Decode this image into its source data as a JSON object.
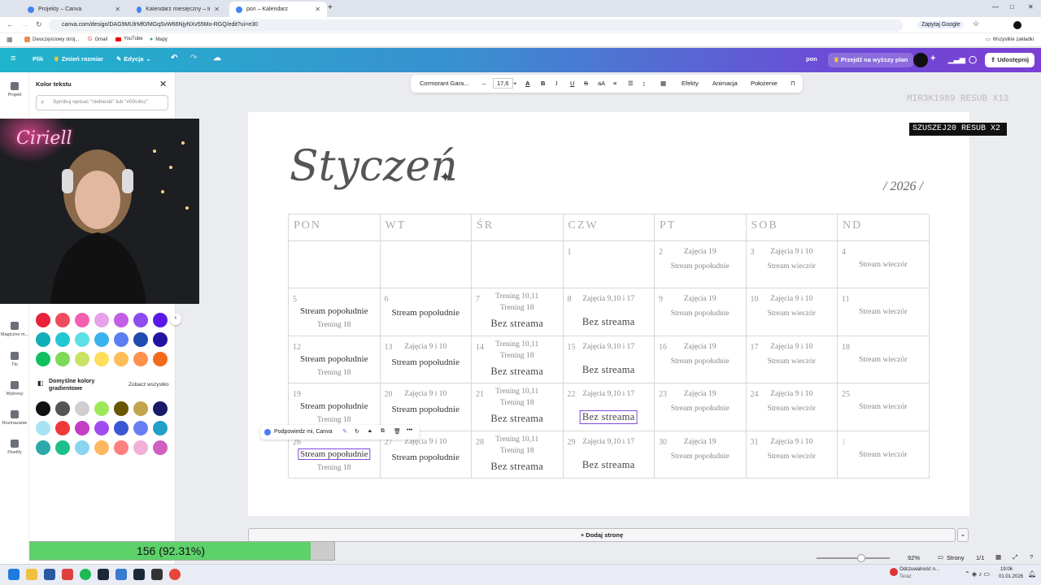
{
  "browser": {
    "tabs": [
      {
        "label": "Projekty – Canva",
        "active": false
      },
      {
        "label": "Kalendarz miesięczny – listopa...",
        "active": false
      },
      {
        "label": "pon – Kalendarz",
        "active": true
      }
    ],
    "url": "canva.com/design/DAG9MUlrMf0/MGqSvW66NjyNXv55Mo-RGQ/edit?ui=e30",
    "google_btn": "Zapytaj Google",
    "bookmarks": [
      "Dwuczęściowy stroj...",
      "Gmail",
      "YouTube",
      "Mapy"
    ],
    "all_bookmarks": "Wszystkie zakładki"
  },
  "canva_header": {
    "file": "Plik",
    "resize": "Zmień rozmiar",
    "edit": "Edycja",
    "project_name": "pon",
    "upgrade": "Przejdź na wyższy plan",
    "share": "Udostępnij"
  },
  "rail": [
    "Projekt",
    "Magiczne m...",
    "Tło",
    "Wykresy",
    "Rozmazanie",
    "Pixelify"
  ],
  "color_panel": {
    "title": "Kolor tekstu",
    "search_placeholder": "Spróbuj wpisać \"niebieski\" lub \"#00c4cc\"",
    "gradient_title": "Domyślne kolory gradientowe",
    "see_all": "Zobacz wszystko",
    "solid_rows": [
      [
        "#e9213a",
        "#f04c5f",
        "#f55fb0",
        "#e9a1ea",
        "#c25ee6",
        "#8e4cf0",
        "#5a18e8"
      ],
      [
        "#10aeb8",
        "#22c7d4",
        "#5ce0e6",
        "#3bb2f0",
        "#5b7ff2",
        "#1f4ab0",
        "#2412a0"
      ],
      [
        "#10c060",
        "#7ed957",
        "#c9e265",
        "#ffde59",
        "#ffbd59",
        "#ff914d",
        "#f26b1d"
      ]
    ],
    "gradient_rows": [
      [
        "#111111",
        "#555555",
        "#cfcfcf",
        "#9ee85a",
        "#6a5500",
        "#c2a44a",
        "#1a1a6a"
      ],
      [
        "#a7e3f5",
        "#ee3a3a",
        "#c23ec4",
        "#a04cf0",
        "#3a56d4",
        "#6a7ef4",
        "#20a0c8"
      ],
      [
        "#2ea8a8",
        "#1ec08a",
        "#8ad4f0",
        "#ffb860",
        "#ff8080",
        "#f0b0d8",
        "#d060c0"
      ]
    ]
  },
  "toolbar": {
    "font": "Cormorant Gara...",
    "size": "17,6",
    "effects": "Efekty",
    "animation": "Animacja",
    "position": "Położenie"
  },
  "overlay": {
    "sub_top": "MIR3K1989  RESUB X13",
    "sub_main": "SZUSZEJ20  RESUB X2",
    "webcam_sign": "Ciriell"
  },
  "calendar": {
    "month": "Styczeń",
    "year": "/ 2026 /",
    "days": [
      "PON",
      "WT",
      "ŚR",
      "CZW",
      "PT",
      "SOB",
      "ND"
    ],
    "weeks": [
      [
        {
          "n": "",
          "lines": []
        },
        {
          "n": "",
          "lines": []
        },
        {
          "n": "",
          "lines": []
        },
        {
          "n": "1",
          "lines": []
        },
        {
          "n": "2",
          "lines": [
            {
              "t": "Zajęcia 19",
              "s": "l"
            },
            {
              "t": "Stream popołudnie",
              "s": "l"
            }
          ]
        },
        {
          "n": "3",
          "lines": [
            {
              "t": "Zajęcia 9 i 10",
              "s": "l"
            },
            {
              "t": "Stream wieczór",
              "s": "l"
            }
          ]
        },
        {
          "n": "4",
          "lines": [
            {
              "t": "Stream wieczór",
              "s": "l"
            }
          ]
        }
      ],
      [
        {
          "n": "5",
          "lines": [
            {
              "t": "Stream popołudnie",
              "s": "d"
            },
            {
              "t": "Trening 18",
              "s": "l"
            }
          ]
        },
        {
          "n": "6",
          "lines": [
            {
              "t": "Stream popołudnie",
              "s": "d"
            }
          ]
        },
        {
          "n": "7",
          "lines": [
            {
              "t": "Trening 10,11",
              "s": "l"
            },
            {
              "t": "Trening 18",
              "s": "l"
            },
            {
              "t": "Bez streama",
              "s": "b"
            }
          ]
        },
        {
          "n": "8",
          "lines": [
            {
              "t": "Zajęcia 9,10 i 17",
              "s": "l"
            },
            {
              "t": "Bez streama",
              "s": "b"
            }
          ]
        },
        {
          "n": "9",
          "lines": [
            {
              "t": "Zajęcia 19",
              "s": "l"
            },
            {
              "t": "Stream popołudnie",
              "s": "l"
            }
          ]
        },
        {
          "n": "10",
          "lines": [
            {
              "t": "Zajęcia 9 i 10",
              "s": "l"
            },
            {
              "t": "Stream wieczór",
              "s": "l"
            }
          ]
        },
        {
          "n": "11",
          "lines": [
            {
              "t": "Stream wieczór",
              "s": "l"
            }
          ]
        }
      ],
      [
        {
          "n": "12",
          "lines": [
            {
              "t": "Stream popołudnie",
              "s": "d"
            },
            {
              "t": "Trening 18",
              "s": "l"
            }
          ]
        },
        {
          "n": "13",
          "lines": [
            {
              "t": "Zajęcia 9 i 10",
              "s": "l"
            },
            {
              "t": "Stream popołudnie",
              "s": "d"
            }
          ]
        },
        {
          "n": "14",
          "lines": [
            {
              "t": "Trening 10,11",
              "s": "l"
            },
            {
              "t": "Trening 18",
              "s": "l"
            },
            {
              "t": "Bez streama",
              "s": "b"
            }
          ]
        },
        {
          "n": "15",
          "lines": [
            {
              "t": "Zajęcia 9,10 i 17",
              "s": "l"
            },
            {
              "t": "Bez streama",
              "s": "b"
            }
          ]
        },
        {
          "n": "16",
          "lines": [
            {
              "t": "Zajęcia 19",
              "s": "l"
            },
            {
              "t": "Stream popołudnie",
              "s": "l"
            }
          ]
        },
        {
          "n": "17",
          "lines": [
            {
              "t": "Zajęcia 9 i 10",
              "s": "l"
            },
            {
              "t": "Stream wieczór",
              "s": "l"
            }
          ]
        },
        {
          "n": "18",
          "lines": [
            {
              "t": "Stream wieczór",
              "s": "l"
            }
          ]
        }
      ],
      [
        {
          "n": "19",
          "lines": [
            {
              "t": "Stream popołudnie",
              "s": "d"
            },
            {
              "t": "Trening 18",
              "s": "l"
            }
          ]
        },
        {
          "n": "20",
          "lines": [
            {
              "t": "Zajęcia 9 i 10",
              "s": "l"
            },
            {
              "t": "Stream popołudnie",
              "s": "d"
            }
          ]
        },
        {
          "n": "21",
          "lines": [
            {
              "t": "Trening 10,11",
              "s": "l"
            },
            {
              "t": "Trening 18",
              "s": "l"
            },
            {
              "t": "Bez streama",
              "s": "b"
            }
          ]
        },
        {
          "n": "22",
          "lines": [
            {
              "t": "Zajęcia 9,10 i 17",
              "s": "l"
            },
            {
              "t": "Bez streama",
              "s": "b",
              "sel": true
            }
          ]
        },
        {
          "n": "23",
          "lines": [
            {
              "t": "Zajęcia 19",
              "s": "l"
            },
            {
              "t": "Stream popołudnie",
              "s": "l"
            }
          ]
        },
        {
          "n": "24",
          "lines": [
            {
              "t": "Zajęcia 9 i 10",
              "s": "l"
            },
            {
              "t": "Stream wieczór",
              "s": "l"
            }
          ]
        },
        {
          "n": "25",
          "lines": [
            {
              "t": "Stream wieczór",
              "s": "l"
            }
          ]
        }
      ],
      [
        {
          "n": "26",
          "lines": [
            {
              "t": "Stream popołudnie",
              "s": "d",
              "sel": true
            },
            {
              "t": "Trening 18",
              "s": "l"
            }
          ]
        },
        {
          "n": "27",
          "lines": [
            {
              "t": "Zajęcia 9 i 10",
              "s": "l"
            },
            {
              "t": "Stream popołudnie",
              "s": "d"
            }
          ]
        },
        {
          "n": "28",
          "lines": [
            {
              "t": "Trening 10,11",
              "s": "l"
            },
            {
              "t": "Trening 18",
              "s": "l"
            },
            {
              "t": "Bez streama",
              "s": "b"
            }
          ]
        },
        {
          "n": "29",
          "lines": [
            {
              "t": "Zajęcia 9,10 i 17",
              "s": "l"
            },
            {
              "t": "Bez streama",
              "s": "b"
            }
          ]
        },
        {
          "n": "30",
          "lines": [
            {
              "t": "Zajęcia 19",
              "s": "l"
            },
            {
              "t": "Stream popołudnie",
              "s": "l"
            }
          ]
        },
        {
          "n": "31",
          "lines": [
            {
              "t": "Zajęcia 9 i 10",
              "s": "l"
            },
            {
              "t": "Stream wieczór",
              "s": "l"
            }
          ]
        },
        {
          "n": "1",
          "lines": [
            {
              "t": "Stream wieczór",
              "s": "l"
            }
          ]
        }
      ]
    ]
  },
  "context_menu": {
    "ai": "Podpowiedz mi, Canva"
  },
  "add_page": "+ Dodaj stronę",
  "progress": {
    "label": "156 (92.31%)",
    "fraction": 0.9231
  },
  "statusbar": {
    "zoom": "92%",
    "pages": "Strony",
    "page_count": "1/1"
  },
  "taskbar": {
    "notif": "Odczuwalność n...",
    "notif_sub": "Teraz",
    "time": "19:06",
    "date": "01.01.2026"
  }
}
